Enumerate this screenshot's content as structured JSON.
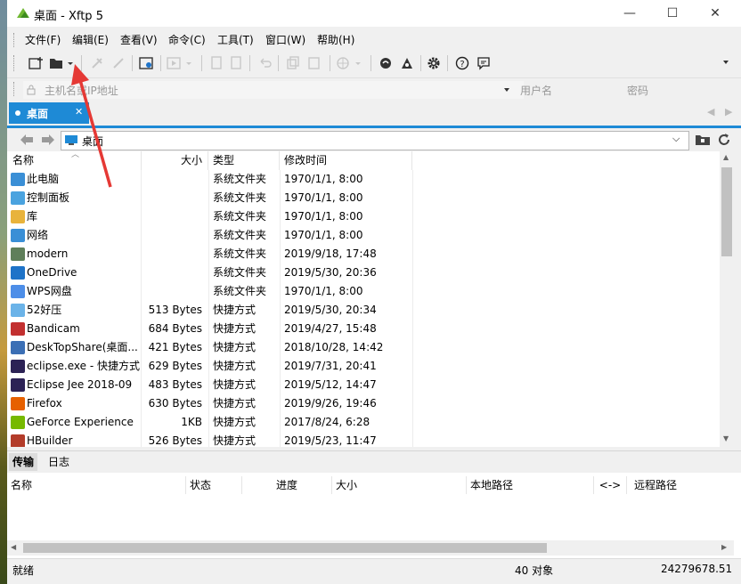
{
  "window": {
    "title": "桌面 - Xftp 5",
    "controls": {
      "minimize": "—",
      "maximize": "☐",
      "close": "✕"
    }
  },
  "menu": [
    "文件(F)",
    "编辑(E)",
    "查看(V)",
    "命令(C)",
    "工具(T)",
    "窗口(W)",
    "帮助(H)"
  ],
  "address_bar": {
    "host_placeholder": "主机名或IP地址",
    "user_placeholder": "用户名",
    "password_placeholder": "密码"
  },
  "tab": {
    "label": "桌面"
  },
  "path": {
    "value": "桌面"
  },
  "columns": [
    "名称",
    "大小",
    "类型",
    "修改时间"
  ],
  "files": [
    {
      "name": "此电脑",
      "size": "",
      "type": "系统文件夹",
      "modified": "1970/1/1, 8:00",
      "icon": "computer-icon",
      "color": "#3a8fd6"
    },
    {
      "name": "控制面板",
      "size": "",
      "type": "系统文件夹",
      "modified": "1970/1/1, 8:00",
      "icon": "control-panel-icon",
      "color": "#4aa3df"
    },
    {
      "name": "库",
      "size": "",
      "type": "系统文件夹",
      "modified": "1970/1/1, 8:00",
      "icon": "library-icon",
      "color": "#e8b33c"
    },
    {
      "name": "网络",
      "size": "",
      "type": "系统文件夹",
      "modified": "1970/1/1, 8:00",
      "icon": "network-icon",
      "color": "#3a8fd6"
    },
    {
      "name": "modern",
      "size": "",
      "type": "系统文件夹",
      "modified": "2019/9/18, 17:48",
      "icon": "user-icon",
      "color": "#5f7f5a"
    },
    {
      "name": "OneDrive",
      "size": "",
      "type": "系统文件夹",
      "modified": "2019/5/30, 20:36",
      "icon": "onedrive-icon",
      "color": "#1e73c8"
    },
    {
      "name": "WPS网盘",
      "size": "",
      "type": "系统文件夹",
      "modified": "1970/1/1, 8:00",
      "icon": "wps-cloud-icon",
      "color": "#4d8ee8"
    },
    {
      "name": "52好压",
      "size": "513 Bytes",
      "type": "快捷方式",
      "modified": "2019/5/30, 20:34",
      "icon": "52haoya-icon",
      "color": "#6bb3e8"
    },
    {
      "name": "Bandicam",
      "size": "684 Bytes",
      "type": "快捷方式",
      "modified": "2019/4/27, 15:48",
      "icon": "bandicam-icon",
      "color": "#c23030"
    },
    {
      "name": "DeskTopShare(桌面...",
      "size": "421 Bytes",
      "type": "快捷方式",
      "modified": "2018/10/28, 14:42",
      "icon": "desktopshare-icon",
      "color": "#3b6fb5"
    },
    {
      "name": "eclipse.exe - 快捷方式",
      "size": "629 Bytes",
      "type": "快捷方式",
      "modified": "2019/7/31, 20:41",
      "icon": "eclipse-icon",
      "color": "#2c2255"
    },
    {
      "name": "Eclipse Jee 2018-09",
      "size": "483 Bytes",
      "type": "快捷方式",
      "modified": "2019/5/12, 14:47",
      "icon": "eclipse-icon",
      "color": "#2c2255"
    },
    {
      "name": "Firefox",
      "size": "630 Bytes",
      "type": "快捷方式",
      "modified": "2019/9/26, 19:46",
      "icon": "firefox-icon",
      "color": "#e66000"
    },
    {
      "name": "GeForce Experience",
      "size": "1KB",
      "type": "快捷方式",
      "modified": "2017/8/24, 6:28",
      "icon": "geforce-icon",
      "color": "#76b900"
    },
    {
      "name": "HBuilder",
      "size": "526 Bytes",
      "type": "快捷方式",
      "modified": "2019/5/23, 11:47",
      "icon": "hbuilder-icon",
      "color": "#b33c2a"
    }
  ],
  "transfer": {
    "tabs": [
      "传输",
      "日志"
    ],
    "columns": [
      "名称",
      "状态",
      "进度",
      "大小",
      "本地路径",
      "<->",
      "远程路径"
    ]
  },
  "status": {
    "left": "就绪",
    "count": "40 对象",
    "size": "24279678.51"
  },
  "colors": {
    "accent": "#1e8ad6",
    "arrow": "#e53935"
  }
}
